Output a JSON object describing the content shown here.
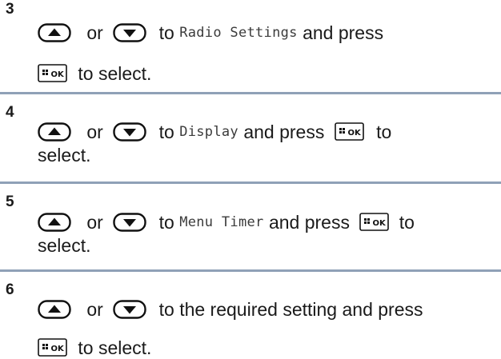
{
  "steps": [
    {
      "number": "3",
      "or_text": "or",
      "to_text": "to",
      "menu_item": "Radio Settings",
      "and_press": "and press",
      "to_select": "to select."
    },
    {
      "number": "4",
      "or_text": "or",
      "to_text": "to",
      "menu_item": "Display",
      "and_press": "and press",
      "to_text2": "to",
      "select_text": "select."
    },
    {
      "number": "5",
      "or_text": "or",
      "to_text": "to",
      "menu_item": "Menu Timer",
      "and_press": "and press",
      "to_text2": "to",
      "select_text": "select."
    },
    {
      "number": "6",
      "or_text": "or",
      "to_text": "to the required setting and press",
      "to_select": "to select."
    }
  ],
  "icons": {
    "up": "up-arrow-key-icon",
    "down": "down-arrow-key-icon",
    "ok": "menu-ok-key-icon",
    "ok_label": "OK"
  },
  "colors": {
    "divider": "#8fa1b7",
    "text": "#1a1a1a"
  }
}
